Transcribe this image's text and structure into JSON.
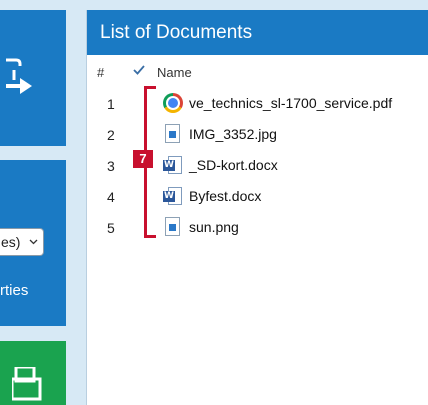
{
  "left_sidebar": {
    "combo_value": "es)",
    "properties_link": "rties"
  },
  "documents_panel": {
    "title": "List of Documents",
    "columns": {
      "number": "#",
      "name": "Name"
    },
    "rows": [
      {
        "num": "1",
        "name": "ve_technics_sl-1700_service.pdf",
        "icon": "chrome-icon"
      },
      {
        "num": "2",
        "name": "IMG_3352.jpg",
        "icon": "image-file-icon"
      },
      {
        "num": "3",
        "name": "_SD-kort.docx",
        "icon": "word-icon"
      },
      {
        "num": "4",
        "name": "Byfest.docx",
        "icon": "word-icon"
      },
      {
        "num": "5",
        "name": "sun.png",
        "icon": "image-file-icon"
      }
    ]
  },
  "annotation": {
    "marker_label": "7",
    "color": "#c8102e"
  },
  "colors": {
    "accent_blue": "#1a7ac4",
    "green": "#1aa34f",
    "background": "#d7e9f5"
  }
}
